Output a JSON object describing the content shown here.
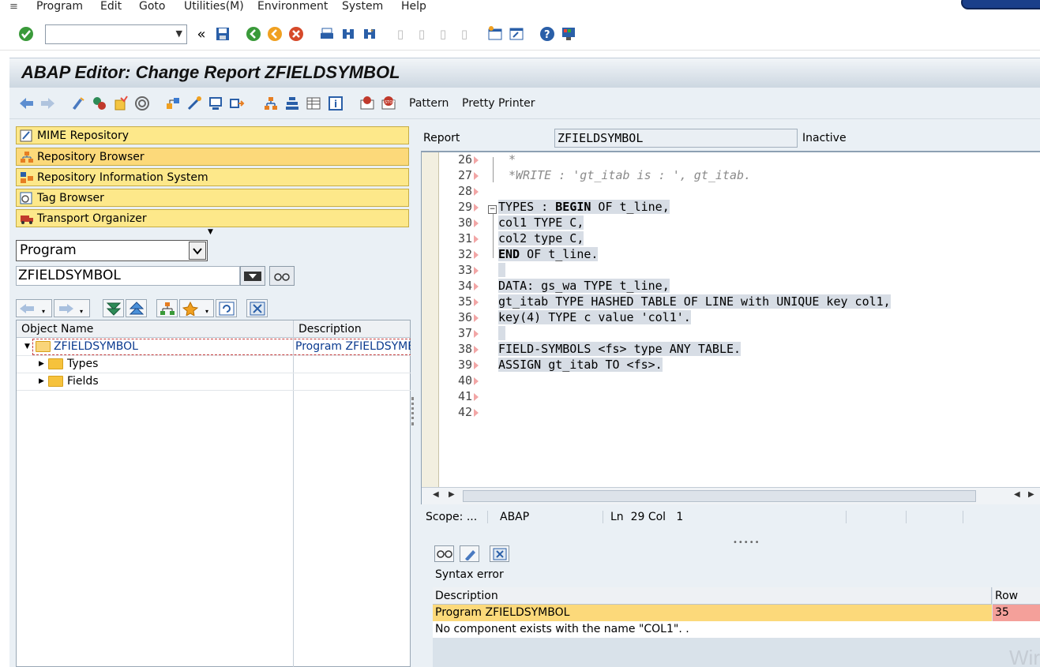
{
  "menu": {
    "items": [
      "Program",
      "Edit",
      "Goto",
      "Utilities(M)",
      "Environment",
      "System",
      "Help"
    ]
  },
  "title": "ABAP Editor: Change Report ZFIELDSYMBOL",
  "app_toolbar": {
    "pattern_label": "Pattern",
    "pretty_printer_label": "Pretty Printer"
  },
  "navigator": {
    "buttons": [
      "MIME Repository",
      "Repository Browser",
      "Repository Information System",
      "Tag Browser",
      "Transport Organizer"
    ],
    "object_type": "Program",
    "object_name": "ZFIELDSYMBOL"
  },
  "tree": {
    "columns": [
      "Object Name",
      "Description"
    ],
    "rows": [
      {
        "name": "ZFIELDSYMBOL",
        "description": "Program ZFIELDSYMBOL"
      },
      {
        "name": "Types",
        "description": ""
      },
      {
        "name": "Fields",
        "description": ""
      }
    ]
  },
  "editor": {
    "report_label": "Report",
    "report_name": "ZFIELDSYMBOL",
    "status": "Inactive",
    "lines": [
      {
        "n": "26",
        "text": "*"
      },
      {
        "n": "27",
        "text": "*WRITE : 'gt_itab is : ', gt_itab."
      },
      {
        "n": "28",
        "text": ""
      },
      {
        "n": "29",
        "text": "TYPES : BEGIN OF t_line,"
      },
      {
        "n": "30",
        "text": "col1 TYPE C,"
      },
      {
        "n": "31",
        "text": "col2 type C,"
      },
      {
        "n": "32",
        "text": "END OF t_line."
      },
      {
        "n": "33",
        "text": ""
      },
      {
        "n": "34",
        "text": "DATA: gs_wa TYPE t_line,"
      },
      {
        "n": "35",
        "text": "gt_itab TYPE HASHED TABLE OF LINE with UNIQUE key col1,"
      },
      {
        "n": "36",
        "text": "key(4) TYPE c value 'col1'."
      },
      {
        "n": "37",
        "text": ""
      },
      {
        "n": "38",
        "text": "FIELD-SYMBOLS <fs> type ANY TABLE."
      },
      {
        "n": "39",
        "text": "ASSIGN gt_itab TO <fs>."
      },
      {
        "n": "40",
        "text": ""
      },
      {
        "n": "41",
        "text": ""
      },
      {
        "n": "42",
        "text": ""
      }
    ],
    "status_bar": {
      "scope": "Scope: ...",
      "language": "ABAP",
      "position": "Ln  29 Col   1"
    }
  },
  "errors": {
    "heading": "Syntax error",
    "columns": [
      "Description",
      "Row"
    ],
    "rows": [
      {
        "description": "Program ZFIELDSYMBOL",
        "row": "35"
      },
      {
        "description": "No component exists with the name \"COL1\". .",
        "row": ""
      }
    ]
  },
  "watermark": "Wir",
  "colors": {
    "nav_button": "#fde88a",
    "selected_row": "#fcd97a",
    "error_row_cell": "#f4a09a",
    "code_highlight": "#d7dde5"
  }
}
